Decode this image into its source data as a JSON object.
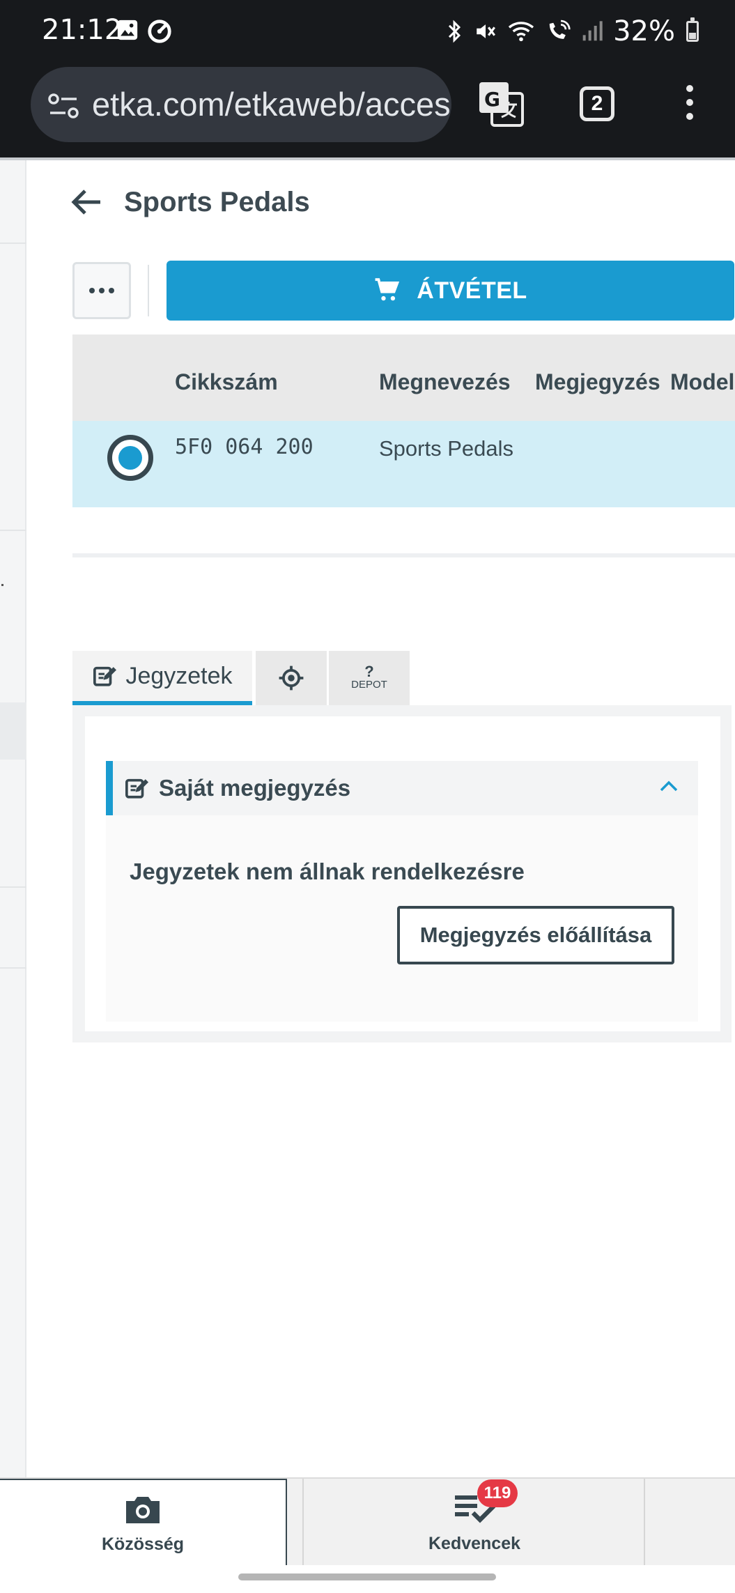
{
  "status_bar": {
    "time": "21:12",
    "battery": "32%",
    "icons": [
      "image-icon",
      "sync-icon",
      "bluetooth-icon",
      "mute-icon",
      "wifi-icon",
      "wifi-call-icon",
      "signal-icon",
      "battery-icon"
    ]
  },
  "browser": {
    "url": "etka.com/etkaweb/access",
    "tab_count": "2",
    "icons": [
      "site-settings-icon",
      "translate-icon",
      "tabs-icon",
      "more-vert-icon"
    ]
  },
  "page": {
    "title": "Sports Pedals",
    "toolbar": {
      "more_label": "•••",
      "accept_label": "ÁTVÉTEL"
    },
    "table": {
      "columns": [
        "Cikkszám",
        "Megnevezés",
        "Megjegyzés",
        "Model"
      ],
      "rows": [
        {
          "part_number": "5F0 064 200",
          "name": "Sports Pedals",
          "note": "",
          "model": "",
          "selected": true
        }
      ]
    },
    "tabs": {
      "notes_label": "Jegyzetek",
      "depot_mark": "?",
      "depot_label": "DEPOT"
    },
    "notes": {
      "section_title": "Saját megjegyzés",
      "empty_text": "Jegyzetek nem állnak rendelkezésre",
      "create_button": "Megjegyzés előállítása"
    }
  },
  "bottom_nav": {
    "community_label": "Közösség",
    "favorites_label": "Kedvencek",
    "favorites_badge": "119"
  },
  "colors": {
    "accent": "#1a9bd0",
    "selected_row": "#d2eef7",
    "badge": "#e53945",
    "text": "#37474f"
  }
}
